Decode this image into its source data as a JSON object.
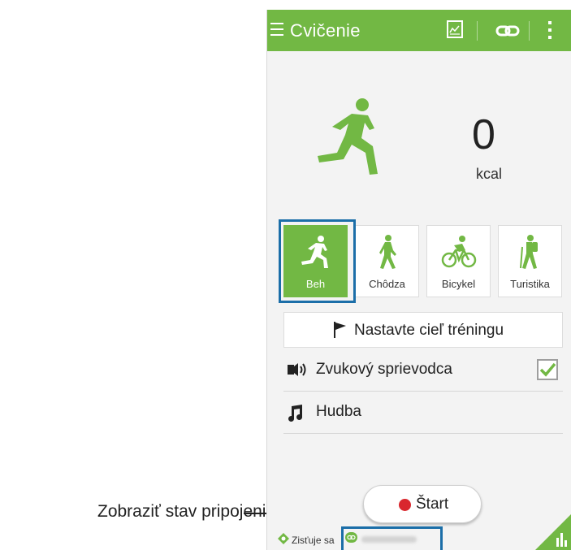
{
  "app": {
    "title": "Cvičenie",
    "accent_color": "#72b844",
    "highlight_color": "#1b6ea8",
    "icons": [
      "menu-icon",
      "chart-icon",
      "link-icon",
      "overflow-menu-icon"
    ]
  },
  "summary": {
    "value": "0",
    "unit": "kcal",
    "icon": "running-icon"
  },
  "activities": [
    {
      "label": "Beh",
      "icon": "running-icon",
      "selected": true
    },
    {
      "label": "Chôdza",
      "icon": "walking-icon",
      "selected": false
    },
    {
      "label": "Bicykel",
      "icon": "cycling-icon",
      "selected": false
    },
    {
      "label": "Turistika",
      "icon": "hiking-icon",
      "selected": false
    }
  ],
  "goal": {
    "label": "Nastavte cieľ tréningu",
    "icon": "flag-icon"
  },
  "settings": [
    {
      "label": "Zvukový sprievodca",
      "icon": "audio-guide-icon",
      "checked": true
    },
    {
      "label": "Hudba",
      "icon": "music-note-icon"
    }
  ],
  "start": {
    "label": "Štart",
    "status_color": "#d9272e"
  },
  "status_bar": {
    "gps_label": "Zisťuje sa",
    "gps_icon": "gps-icon",
    "connection_icon": "connection-icon"
  },
  "callout": {
    "text": "Zobraziť stav pripojenia."
  }
}
